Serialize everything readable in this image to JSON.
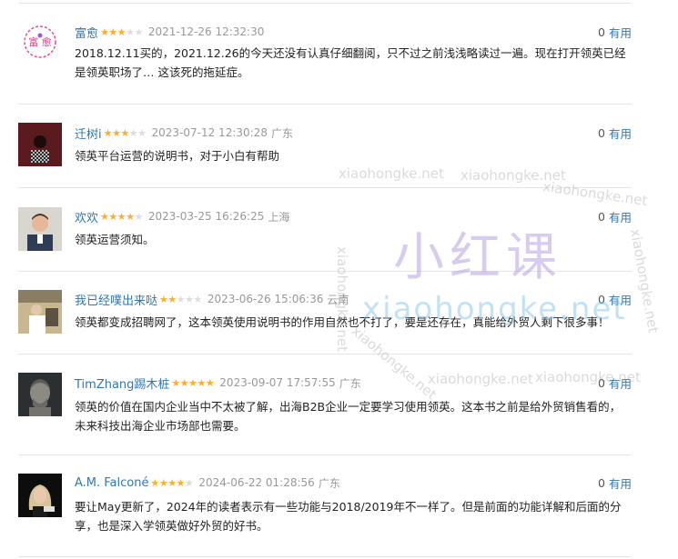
{
  "comments": [
    {
      "user": "富愈",
      "stars": 3,
      "time": "2021-12-26 12:32:30",
      "location": "",
      "votes": "0",
      "vote_label": "有用",
      "text": "2018.12.11买的，2021.12.26的今天还没有认真仔细翻阅，只不过之前浅浅略读过一遍。现在打开领英已经是领英职场了… 这该死的拖延症。"
    },
    {
      "user": "迁树i",
      "stars": 3,
      "time": "2023-07-12 12:30:28",
      "location": "广东",
      "votes": "0",
      "vote_label": "有用",
      "text": "领英平台运营的说明书，对于小白有帮助"
    },
    {
      "user": "欢欢",
      "stars": 4,
      "time": "2023-03-25 16:26:25",
      "location": "上海",
      "votes": "0",
      "vote_label": "有用",
      "text": "领英运营须知。"
    },
    {
      "user": "我已经噗出来哒",
      "stars": 2,
      "time": "2023-06-26 15:06:36",
      "location": "云南",
      "votes": "0",
      "vote_label": "有用",
      "text": "领英都变成招聘网了，这本领英使用说明书的作用自然也不打了，要是还存在，真能给外贸人剩下很多事！"
    },
    {
      "user": "TimZhang踢木桩",
      "stars": 5,
      "time": "2023-09-07 17:57:55",
      "location": "广东",
      "votes": "0",
      "vote_label": "有用",
      "text": "领英的价值在国内企业当中不太被了解，出海B2B企业一定要学习使用领英。这本书之前是给外贸销售看的，未来科技出海企业市场部也需要。"
    },
    {
      "user": "A.M. Falconé",
      "stars": 4,
      "time": "2024-06-22 01:28:56",
      "location": "广东",
      "votes": "0",
      "vote_label": "有用",
      "text": "要让May更新了，2024年的读者表示有一些功能与2018/2019年不一样了。但是前面的功能详解和后面的分享，也是深入学领英做好外贸的好书。"
    }
  ],
  "watermark": {
    "domain": "xiaohongke.net",
    "cn": "小红课"
  },
  "colors": {
    "link": "#3377aa",
    "star": "#ffac2d",
    "meta": "#999999",
    "text": "#222222",
    "divider": "#e5e5e5"
  }
}
